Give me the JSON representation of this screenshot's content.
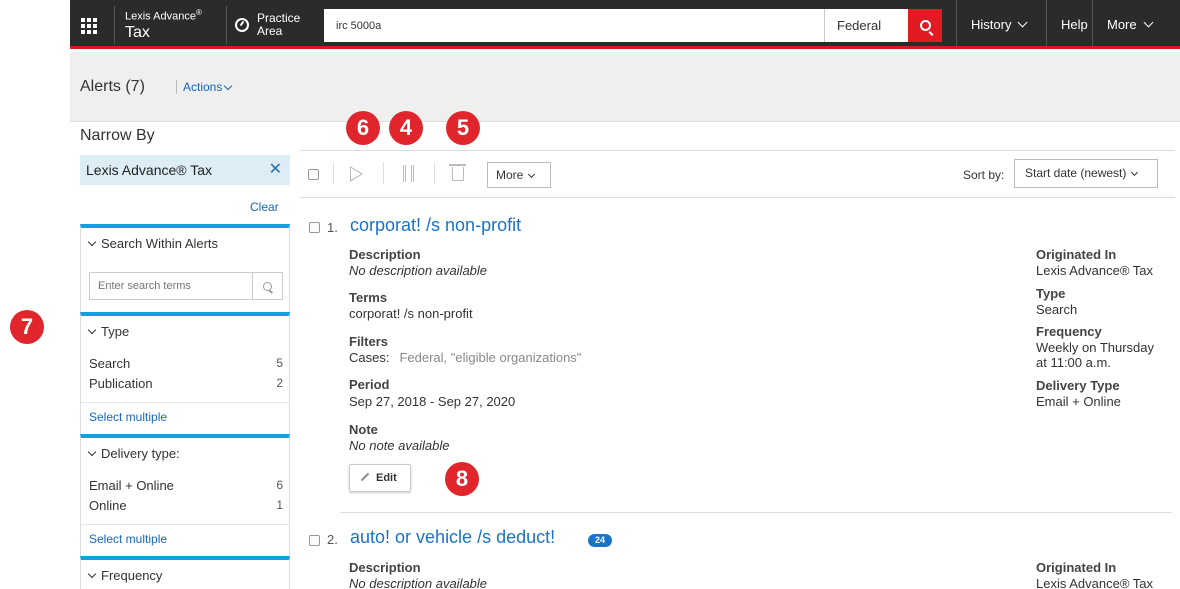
{
  "app": {
    "brand_line1": "Lexis Advance",
    "brand_reg": "®",
    "brand_line2": "Tax",
    "practice_line1": "Practice",
    "practice_line2": "Area"
  },
  "search": {
    "value": "irc 5000a",
    "jurisdiction": "Federal"
  },
  "nav": {
    "history": "History",
    "help": "Help",
    "more": "More"
  },
  "header": {
    "title": "Alerts (7)",
    "actions": "Actions"
  },
  "sidebar": {
    "narrow_by": "Narrow By",
    "active_filter": "Lexis Advance® Tax",
    "remove": "✕",
    "clear": "Clear",
    "search_within": {
      "label": "Search Within Alerts",
      "placeholder": "Enter search terms"
    },
    "type": {
      "label": "Type",
      "items": [
        {
          "label": "Search",
          "count": "5"
        },
        {
          "label": "Publication",
          "count": "2"
        }
      ],
      "select_multiple": "Select multiple"
    },
    "delivery": {
      "label": "Delivery type:",
      "items": [
        {
          "label": "Email + Online",
          "count": "6"
        },
        {
          "label": "Online",
          "count": "1"
        }
      ],
      "select_multiple": "Select multiple"
    },
    "frequency": {
      "label": "Frequency"
    }
  },
  "toolbar": {
    "more": "More",
    "sort_label": "Sort by:",
    "sort_value": "Start date (newest)"
  },
  "callouts": {
    "c6": "6",
    "c4": "4",
    "c5": "5",
    "c7": "7",
    "c8": "8"
  },
  "results": [
    {
      "num": "1.",
      "title": "corporat! /s non-profit",
      "description_label": "Description",
      "description": "No description available",
      "terms_label": "Terms",
      "terms": "corporat! /s non-profit",
      "filters_label": "Filters",
      "filters_key": "Cases:",
      "filters_value": "Federal, \"eligible organizations\"",
      "period_label": "Period",
      "period": "Sep 27, 2018 - Sep 27, 2020",
      "note_label": "Note",
      "note": "No note available",
      "edit": "Edit",
      "originated_label": "Originated In",
      "originated": "Lexis Advance® Tax",
      "type_label": "Type",
      "type": "Search",
      "frequency_label": "Frequency",
      "frequency_line1": "Weekly on Thursday",
      "frequency_line2": "at 11:00 a.m.",
      "delivery_label": "Delivery Type",
      "delivery": "Email + Online"
    },
    {
      "num": "2.",
      "title": "auto! or vehicle /s deduct!",
      "badge": "24",
      "description_label": "Description",
      "description": "No description available",
      "originated_label": "Originated In",
      "originated": "Lexis Advance® Tax"
    }
  ],
  "colors": {
    "nav_bg": "#2b2b2b",
    "accent_red": "#e21b22",
    "link_blue": "#1a73c8",
    "facet_blue": "#14a1dd",
    "callout_red": "#e0262c"
  }
}
